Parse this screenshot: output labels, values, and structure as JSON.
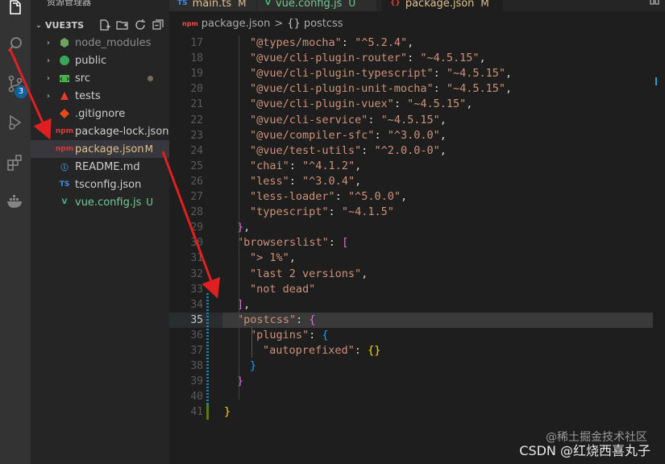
{
  "sidebar": {
    "title": "资源管理器",
    "more": "···",
    "workspace": "VUE3TS",
    "items": [
      {
        "label": "node_modules",
        "status": ""
      },
      {
        "label": "public",
        "status": ""
      },
      {
        "label": "src",
        "status": ""
      },
      {
        "label": "tests",
        "status": ""
      },
      {
        "label": ".gitignore",
        "status": ""
      },
      {
        "label": "package-lock.json",
        "status": ""
      },
      {
        "label": "package.json",
        "status": "M"
      },
      {
        "label": "README.md",
        "status": ""
      },
      {
        "label": "tsconfig.json",
        "status": ""
      },
      {
        "label": "vue.config.js",
        "status": "U"
      }
    ]
  },
  "activity": {
    "scm_badge": "3"
  },
  "tabs": [
    {
      "label": "main.ts",
      "status": "M",
      "icon": "TS"
    },
    {
      "label": "vue.config.js",
      "status": "U",
      "icon": "V"
    },
    {
      "label": "package.json",
      "status": "M",
      "icon": "{}"
    }
  ],
  "breadcrumb": {
    "file": "package.json",
    "symbol": "postcss",
    "separator": ">",
    "brace": "{}"
  },
  "editor": {
    "lines": [
      {
        "n": "17",
        "parts": [
          [
            "s",
            "\"@types/mocha\""
          ],
          [
            "p",
            ": "
          ],
          [
            "s",
            "\"^5.2.4\""
          ],
          [
            "p",
            ","
          ]
        ]
      },
      {
        "n": "18",
        "parts": [
          [
            "s",
            "\"@vue/cli-plugin-router\""
          ],
          [
            "p",
            ": "
          ],
          [
            "s",
            "\"~4.5.15\""
          ],
          [
            "p",
            ","
          ]
        ]
      },
      {
        "n": "19",
        "parts": [
          [
            "s",
            "\"@vue/cli-plugin-typescript\""
          ],
          [
            "p",
            ": "
          ],
          [
            "s",
            "\"~4.5.15\""
          ],
          [
            "p",
            ","
          ]
        ]
      },
      {
        "n": "20",
        "parts": [
          [
            "s",
            "\"@vue/cli-plugin-unit-mocha\""
          ],
          [
            "p",
            ": "
          ],
          [
            "s",
            "\"~4.5.15\""
          ],
          [
            "p",
            ","
          ]
        ]
      },
      {
        "n": "21",
        "parts": [
          [
            "s",
            "\"@vue/cli-plugin-vuex\""
          ],
          [
            "p",
            ": "
          ],
          [
            "s",
            "\"~4.5.15\""
          ],
          [
            "p",
            ","
          ]
        ]
      },
      {
        "n": "22",
        "parts": [
          [
            "s",
            "\"@vue/cli-service\""
          ],
          [
            "p",
            ": "
          ],
          [
            "s",
            "\"~4.5.15\""
          ],
          [
            "p",
            ","
          ]
        ]
      },
      {
        "n": "23",
        "parts": [
          [
            "s",
            "\"@vue/compiler-sfc\""
          ],
          [
            "p",
            ": "
          ],
          [
            "s",
            "\"^3.0.0\""
          ],
          [
            "p",
            ","
          ]
        ]
      },
      {
        "n": "24",
        "parts": [
          [
            "s",
            "\"@vue/test-utils\""
          ],
          [
            "p",
            ": "
          ],
          [
            "s",
            "\"^2.0.0-0\""
          ],
          [
            "p",
            ","
          ]
        ]
      },
      {
        "n": "25",
        "parts": [
          [
            "s",
            "\"chai\""
          ],
          [
            "p",
            ": "
          ],
          [
            "s",
            "\"^4.1.2\""
          ],
          [
            "p",
            ","
          ]
        ]
      },
      {
        "n": "26",
        "parts": [
          [
            "s",
            "\"less\""
          ],
          [
            "p",
            ": "
          ],
          [
            "s",
            "\"^3.0.4\""
          ],
          [
            "p",
            ","
          ]
        ]
      },
      {
        "n": "27",
        "parts": [
          [
            "s",
            "\"less-loader\""
          ],
          [
            "p",
            ": "
          ],
          [
            "s",
            "\"^5.0.0\""
          ],
          [
            "p",
            ","
          ]
        ]
      },
      {
        "n": "28",
        "parts": [
          [
            "s",
            "\"typescript\""
          ],
          [
            "p",
            ": "
          ],
          [
            "s",
            "\"~4.1.5\""
          ]
        ]
      },
      {
        "n": "29",
        "parts": [
          [
            "b2",
            "}"
          ],
          [
            "p",
            ","
          ]
        ]
      },
      {
        "n": "30",
        "parts": [
          [
            "s",
            "\"browserslist\""
          ],
          [
            "p",
            ": "
          ],
          [
            "b2",
            "["
          ]
        ]
      },
      {
        "n": "31",
        "parts": [
          [
            "s",
            "\"> 1%\""
          ],
          [
            "p",
            ","
          ]
        ]
      },
      {
        "n": "32",
        "parts": [
          [
            "s",
            "\"last 2 versions\""
          ],
          [
            "p",
            ","
          ]
        ]
      },
      {
        "n": "33",
        "parts": [
          [
            "s",
            "\"not dead\""
          ]
        ]
      },
      {
        "n": "34",
        "parts": [
          [
            "b2",
            "]"
          ],
          [
            "p",
            ","
          ]
        ]
      },
      {
        "n": "35",
        "parts": [
          [
            "s",
            "\"postcss\""
          ],
          [
            "p",
            ": "
          ],
          [
            "b2",
            "{"
          ]
        ]
      },
      {
        "n": "36",
        "parts": [
          [
            "s",
            "\"plugins\""
          ],
          [
            "p",
            ": "
          ],
          [
            "b3",
            "{"
          ]
        ]
      },
      {
        "n": "37",
        "parts": [
          [
            "s",
            "\"autoprefixed\""
          ],
          [
            "p",
            ": "
          ],
          [
            "b1",
            "{}"
          ]
        ]
      },
      {
        "n": "38",
        "parts": [
          [
            "b3",
            "}"
          ]
        ]
      },
      {
        "n": "39",
        "parts": [
          [
            "b2",
            "}"
          ]
        ]
      },
      {
        "n": "40",
        "parts": []
      },
      {
        "n": "41",
        "parts": [
          [
            "b1",
            "}"
          ]
        ]
      }
    ]
  },
  "watermark": "CSDN @红烧西喜丸子",
  "watermark2": "@稀土掘金技术社区"
}
